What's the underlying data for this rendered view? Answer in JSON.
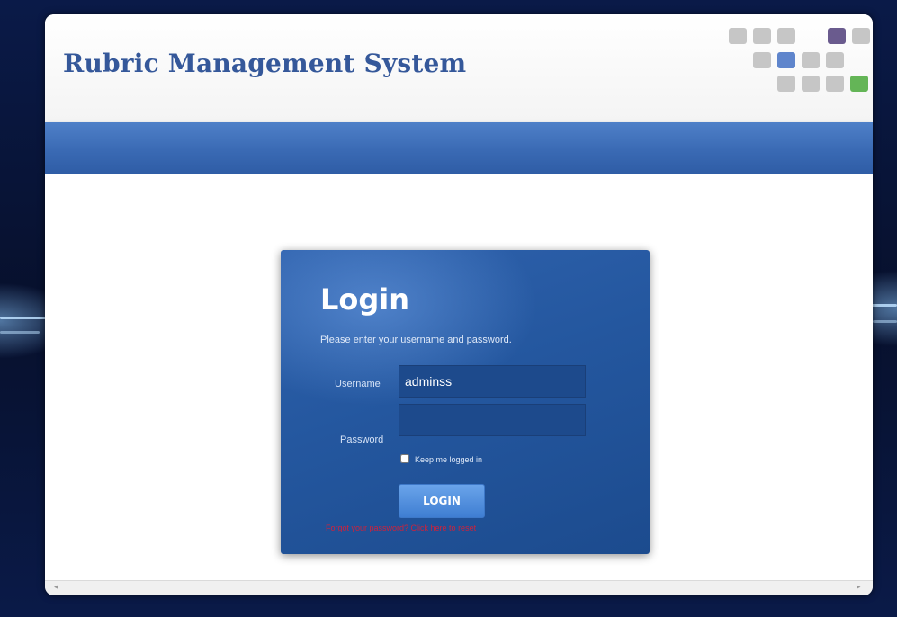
{
  "app": {
    "title": "Rubric Management System"
  },
  "login": {
    "title": "Login",
    "instructions": "Please enter your username and password.",
    "username_label": "Username",
    "username_value": "adminss",
    "password_label": "Password",
    "password_value": "",
    "remember_label": "Keep me logged in",
    "remember_checked": false,
    "submit_label": "LOGIN",
    "forgot_link": "Forgot your password? Click here to reset"
  },
  "icons": {
    "scroll_left": "scroll-left-arrow",
    "scroll_right": "scroll-right-arrow"
  },
  "colors": {
    "title": "#35589a",
    "navbar": "#3a6ab4",
    "panel": "#24579f",
    "button": "#4f8fdd",
    "error_link": "#d0213b"
  }
}
